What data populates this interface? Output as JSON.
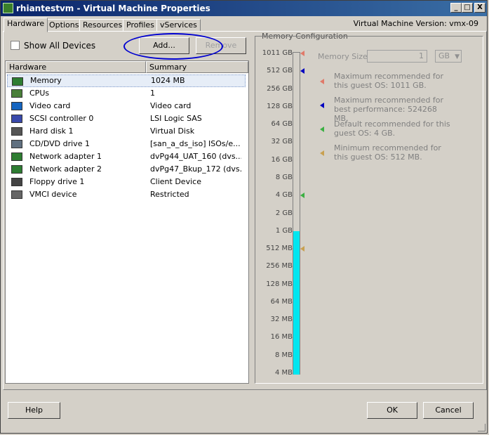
{
  "window": {
    "title": "rhiantestvm - Virtual Machine Properties",
    "minimize": "_",
    "maximize": "□",
    "close": "X"
  },
  "tabs": [
    "Hardware",
    "Options",
    "Resources",
    "Profiles",
    "vServices"
  ],
  "vm_version": "Virtual Machine Version: vmx-09",
  "show_all_devices": "Show All Devices",
  "buttons": {
    "add": "Add...",
    "remove": "Remove",
    "help": "Help",
    "ok": "OK",
    "cancel": "Cancel"
  },
  "table": {
    "columns": [
      "Hardware",
      "Summary"
    ],
    "rows": [
      {
        "name": "Memory",
        "summary": "1024 MB",
        "icon": "memory-icon"
      },
      {
        "name": "CPUs",
        "summary": "1",
        "icon": "cpu-icon"
      },
      {
        "name": "Video card",
        "summary": "Video card",
        "icon": "monitor-icon"
      },
      {
        "name": "SCSI controller 0",
        "summary": "LSI Logic SAS",
        "icon": "scsi-icon"
      },
      {
        "name": "Hard disk 1",
        "summary": "Virtual Disk",
        "icon": "harddisk-icon"
      },
      {
        "name": "CD/DVD drive 1",
        "summary": "[san_a_ds_iso] ISOs/e...",
        "icon": "cd-icon"
      },
      {
        "name": "Network adapter 1",
        "summary": "dvPg44_UAT_160 (dvs...",
        "icon": "network-icon"
      },
      {
        "name": "Network adapter 2",
        "summary": "dvPg47_Bkup_172 (dvs...",
        "icon": "network-icon"
      },
      {
        "name": "Floppy drive 1",
        "summary": "Client Device",
        "icon": "floppy-icon"
      },
      {
        "name": "VMCI device",
        "summary": "Restricted",
        "icon": "vmci-icon"
      }
    ]
  },
  "memory_config": {
    "group_label": "Memory Configuration",
    "memory_size_label": "Memory Size:",
    "memory_size_value": "1",
    "memory_unit": "GB",
    "scale_labels": [
      "1011 GB",
      "512 GB",
      "256 GB",
      "128 GB",
      "64 GB",
      "32 GB",
      "16 GB",
      "8 GB",
      "4 GB",
      "2 GB",
      "1 GB",
      "512 MB",
      "256 MB",
      "128 MB",
      "64 MB",
      "32 MB",
      "16 MB",
      "8 MB",
      "4 MB"
    ],
    "current_level_label": "1 GB",
    "notes": [
      {
        "text": "Maximum recommended for this guest OS: 1011 GB.",
        "color": "#e07a6a",
        "at": "1011 GB"
      },
      {
        "text": "Maximum recommended for best performance: 524268 MB.",
        "color": "#0000c0",
        "at": "512 GB"
      },
      {
        "text": "Default recommended for this guest OS: 4 GB.",
        "color": "#3cb043",
        "at": "4 GB"
      },
      {
        "text": "Minimum recommended for this guest OS: 512 MB.",
        "color": "#c8a050",
        "at": "512 MB"
      }
    ]
  }
}
